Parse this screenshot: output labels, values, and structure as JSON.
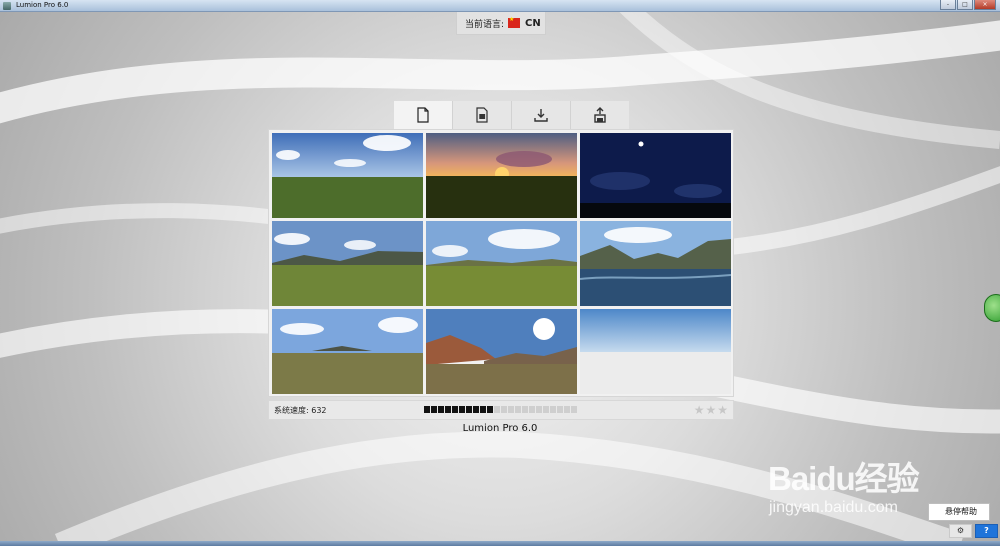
{
  "window": {
    "title": "Lumion Pro 6.0",
    "controls": [
      "-",
      "□",
      "×"
    ]
  },
  "language": {
    "label": "当前语言:",
    "code": "CN",
    "flag_icon": "china-flag-icon"
  },
  "tabs": [
    {
      "name": "new-scene",
      "icon": "document-icon"
    },
    {
      "name": "examples",
      "icon": "document-image-icon"
    },
    {
      "name": "load",
      "icon": "download-icon"
    },
    {
      "name": "save",
      "icon": "upload-icon"
    }
  ],
  "thumbnails": [
    {
      "name": "sunny-grassland"
    },
    {
      "name": "sunset-grassland"
    },
    {
      "name": "night-sky"
    },
    {
      "name": "mountain-grassland"
    },
    {
      "name": "hill-grassland"
    },
    {
      "name": "mountain-lake"
    },
    {
      "name": "dry-grassland"
    },
    {
      "name": "sunny-canyon"
    },
    {
      "name": "empty-sky"
    }
  ],
  "status": {
    "speed_text": "系统速度: 632",
    "meter_filled": 10,
    "meter_total": 22,
    "rating_stars": 3
  },
  "version_text": "Lumion Pro 6.0",
  "watermark": {
    "brand": "Baidu经验",
    "url": "jingyan.baidu.com"
  },
  "hover_help_label": "悬停帮助",
  "help_button": "?",
  "settings_button": "⚙",
  "colors": {
    "accent_blue": "#1f74da",
    "panel_bg": "#f1f1f1"
  }
}
